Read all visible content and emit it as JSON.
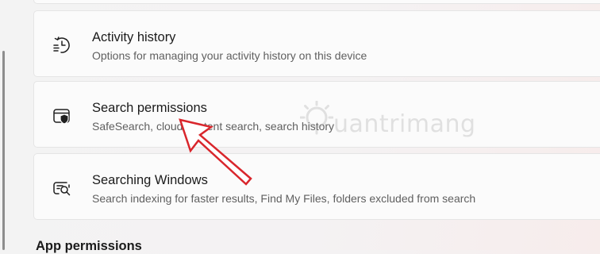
{
  "settings": {
    "items": [
      {
        "title": "Activity history",
        "description": "Options for managing your activity history on this device",
        "icon": "activity-history-icon"
      },
      {
        "title": "Search permissions",
        "description": "SafeSearch, cloud content search, search history",
        "icon": "search-permissions-shield-icon"
      },
      {
        "title": "Searching Windows",
        "description": "Search indexing for faster results, Find My Files, folders excluded from search",
        "icon": "searching-windows-icon"
      }
    ],
    "next_section_heading": "App permissions"
  },
  "watermark": {
    "text": "uantrimang"
  },
  "colors": {
    "arrow": "#d9262c",
    "card_background": "#fbfbfb",
    "title_text": "#1b1b1b",
    "description_text": "#5f5f5f"
  }
}
